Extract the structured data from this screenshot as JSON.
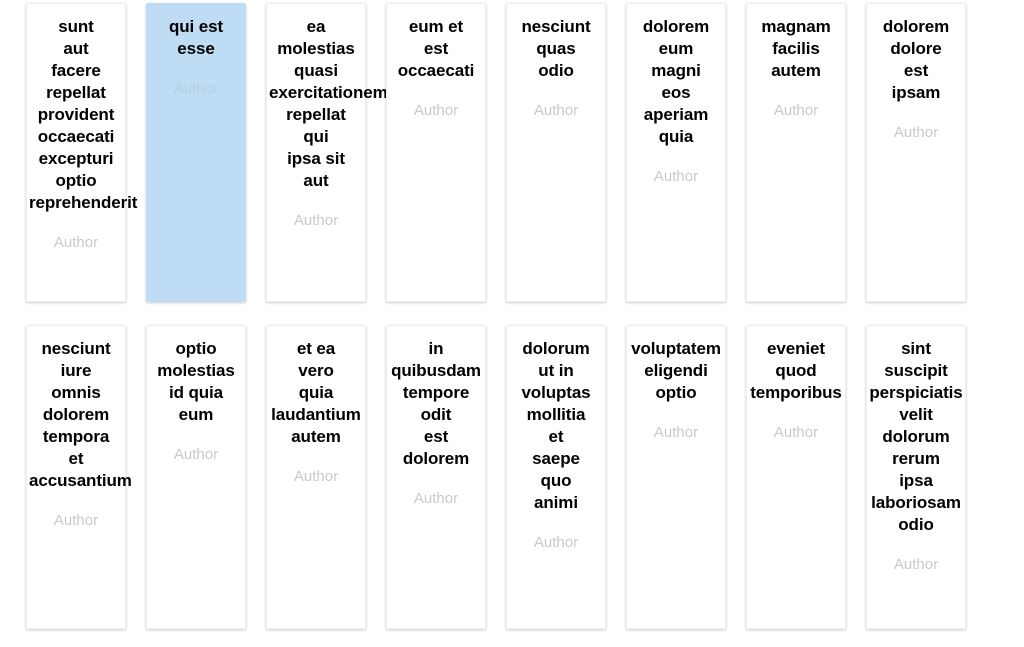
{
  "board": {
    "background_color": "#ffffff",
    "selected_color": "#bedcf4",
    "author_label_color": "#c9c9c9",
    "rows": [
      {
        "cards": [
          {
            "title": "sunt aut facere repellat provident occaecati excepturi optio reprehenderit",
            "words": [
              "sunt",
              "aut",
              "facere",
              "repellat",
              "provident",
              "occaecati",
              "excepturi",
              "optio",
              "reprehenderit"
            ],
            "author": "Author",
            "selected": false
          },
          {
            "title": "qui est esse",
            "words": [
              "qui est",
              "esse"
            ],
            "author": "Author",
            "selected": true
          },
          {
            "title": "ea molestias quasi exercitationem repellat qui ipsa sit aut",
            "words": [
              "ea",
              "molestias",
              "quasi",
              "exercitationem",
              "repellat",
              "qui",
              "ipsa sit",
              "aut"
            ],
            "author": "Author",
            "selected": false
          },
          {
            "title": "eum et est occaecati",
            "words": [
              "eum et",
              "est",
              "occaecati"
            ],
            "author": "Author",
            "selected": false
          },
          {
            "title": "nesciunt quas odio",
            "words": [
              "nesciunt",
              "quas",
              "odio"
            ],
            "author": "Author",
            "selected": false
          },
          {
            "title": "dolorem eum magni eos aperiam quia",
            "words": [
              "dolorem",
              "eum",
              "magni",
              "eos",
              "aperiam",
              "quia"
            ],
            "author": "Author",
            "selected": false
          },
          {
            "title": "magnam facilis autem",
            "words": [
              "magnam",
              "facilis",
              "autem"
            ],
            "author": "Author",
            "selected": false
          },
          {
            "title": "dolorem dolore est ipsam",
            "words": [
              "dolorem",
              "dolore",
              "est",
              "ipsam"
            ],
            "author": "Author",
            "selected": false
          }
        ]
      },
      {
        "cards": [
          {
            "title": "nesciunt iure omnis dolorem tempora et accusantium",
            "words": [
              "nesciunt",
              "iure",
              "omnis",
              "dolorem",
              "tempora",
              "et",
              "accusantium"
            ],
            "author": "Author",
            "selected": false
          },
          {
            "title": "optio molestias id quia eum",
            "words": [
              "optio",
              "molestias",
              "id quia",
              "eum"
            ],
            "author": "Author",
            "selected": false
          },
          {
            "title": "et ea vero quia laudantium autem",
            "words": [
              "et ea",
              "vero",
              "quia",
              "laudantium",
              "autem"
            ],
            "author": "Author",
            "selected": false
          },
          {
            "title": "in quibusdam tempore odit est dolorem",
            "words": [
              "in",
              "quibusdam",
              "tempore",
              "odit",
              "est",
              "dolorem"
            ],
            "author": "Author",
            "selected": false
          },
          {
            "title": "dolorum ut in voluptas mollitia et saepe quo animi",
            "words": [
              "dolorum",
              "ut in",
              "voluptas",
              "mollitia",
              "et",
              "saepe",
              "quo",
              "animi"
            ],
            "author": "Author",
            "selected": false
          },
          {
            "title": "voluptatem eligendi optio",
            "words": [
              "voluptatem",
              "eligendi",
              "optio"
            ],
            "author": "Author",
            "selected": false
          },
          {
            "title": "eveniet quod temporibus",
            "words": [
              "eveniet",
              "quod",
              "temporibus"
            ],
            "author": "Author",
            "selected": false
          },
          {
            "title": "sint suscipit perspiciatis velit dolorum rerum ipsa laboriosam odio",
            "words": [
              "sint",
              "suscipit",
              "perspiciatis",
              "velit",
              "dolorum",
              "rerum",
              "ipsa",
              "laboriosam",
              "odio"
            ],
            "author": "Author",
            "selected": false
          }
        ]
      }
    ]
  }
}
